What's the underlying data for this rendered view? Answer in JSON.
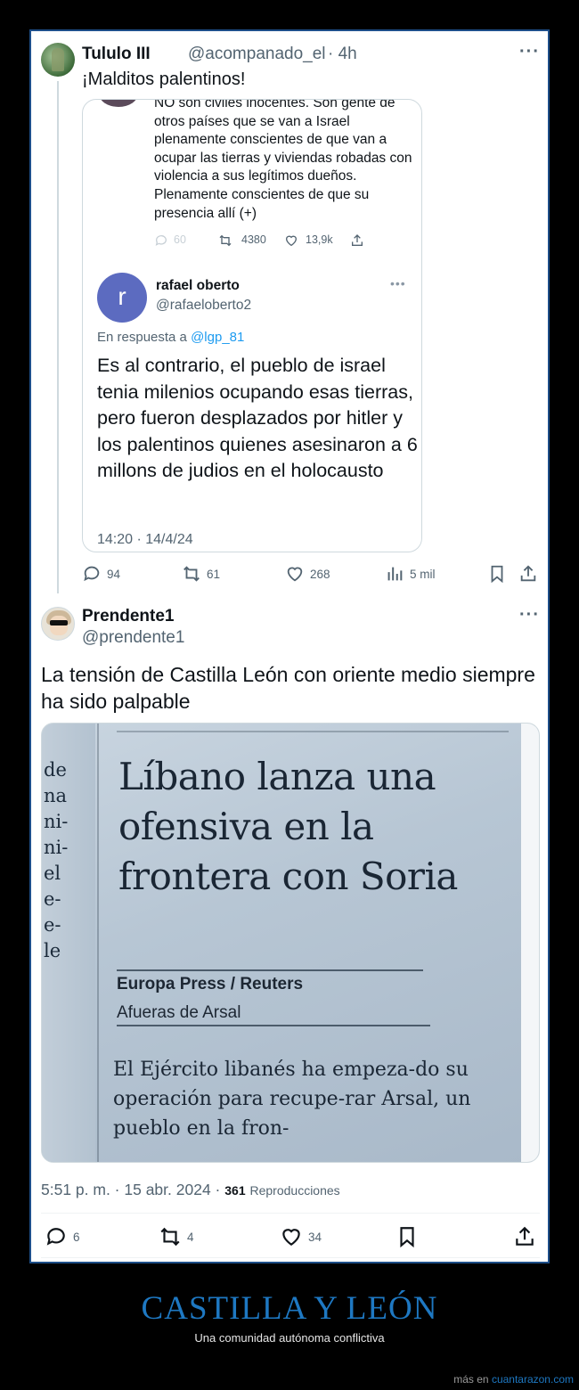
{
  "tweet1": {
    "name": "Tululo III",
    "handle": "@acompanado_el",
    "time": "· 4h",
    "text": "¡Malditos palentinos!",
    "actions": {
      "replies": "94",
      "retweets": "61",
      "likes": "268",
      "views": "5 mil"
    }
  },
  "quote": {
    "prev_text": "NO son civiles inocentes. Son gente de otros países que se van a Israel plenamente conscientes de que van a ocupar las tierras y viviendas robadas con violencia a sus legítimos dueños. Plenamente conscientes de que su presencia allí (+)",
    "prev_actions": {
      "replies": "60",
      "retweets": "4380",
      "likes": "13,9k"
    },
    "avatar_letter": "r",
    "name": "rafael oberto",
    "handle": "@rafaeloberto2",
    "in_reply_prefix": "En respuesta a",
    "in_reply_handle": "@lgp_81",
    "text": "Es al contrario, el pueblo de israel tenia milenios ocupando esas tierras, pero fueron desplazados por hitler y los palentinos quienes asesinaron a 6 millons de judios en el holocausto",
    "timestamp": "14:20 · 14/4/24"
  },
  "tweet2": {
    "name": "Prendente1",
    "handle": "@prendente1",
    "text": "La tensión de Castilla León con oriente medio siempre ha sido palpable",
    "photo": {
      "column_fragments": [
        "de",
        "na",
        "ni-",
        "ni-",
        "el",
        "e-",
        "e-",
        "le"
      ],
      "headline": "Líbano lanza una ofensiva en la frontera con Soria",
      "byline": "Europa Press / Reuters",
      "dateline": "Afueras de Arsal",
      "lede": "El Ejército libanés ha empeza-do su operación para recupe-rar Arsal, un pueblo en la fron-"
    },
    "time": "5:51 p. m. · 15 abr. 2024 ·",
    "views_count": "361",
    "views_label": "Reproducciones",
    "actions": {
      "replies": "6",
      "retweets": "4",
      "likes": "34"
    }
  },
  "footer": {
    "title": "CASTILLA Y LEÓN",
    "subtitle": "Una comunidad autónoma conflictiva",
    "credit_prefix": "más en",
    "credit_link": "cuantarazon.com"
  },
  "icons": [
    "reply-icon",
    "retweet-icon",
    "like-icon",
    "views-icon",
    "bookmark-icon",
    "share-icon",
    "more-icon"
  ],
  "colors": {
    "link": "#1d9bf0",
    "border": "#1d4e89",
    "footer_title": "#1e78c2",
    "avatar_r": "#5c6bc0"
  }
}
